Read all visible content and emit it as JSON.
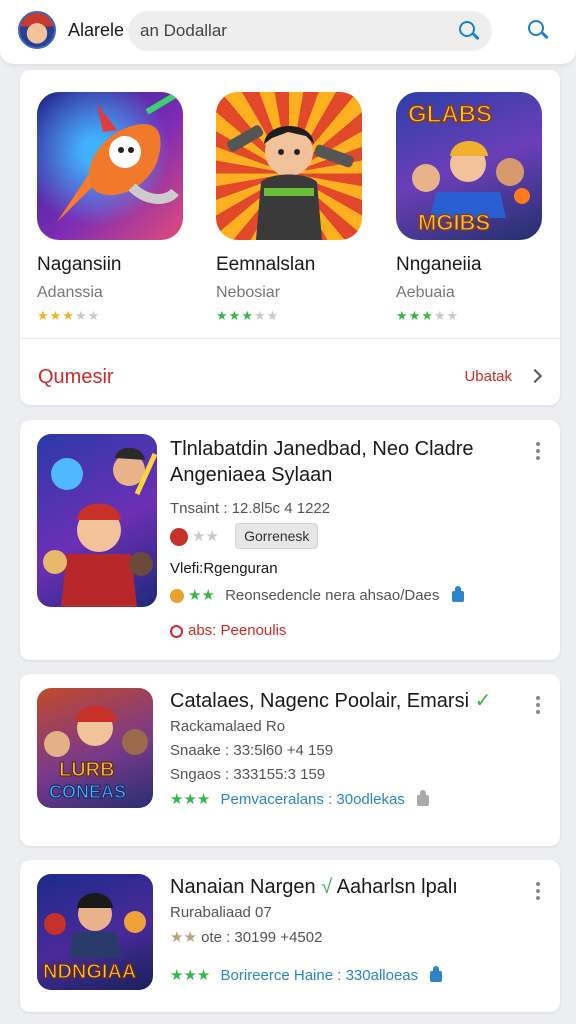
{
  "header": {
    "app_name": "Alarele",
    "search_placeholder": "an Dodallar"
  },
  "featured": {
    "items": [
      {
        "title": "Nagansiin",
        "subtitle": "Adanssia",
        "stars": [
          "on",
          "on",
          "on",
          "off",
          "off"
        ]
      },
      {
        "title": "Eemnalslan",
        "subtitle": "Nebosiar",
        "stars": [
          "green",
          "green",
          "green",
          "off",
          "off"
        ]
      },
      {
        "title": "Nnganeiia",
        "subtitle": "Aebuaia",
        "stars": [
          "green",
          "green",
          "green",
          "off",
          "off"
        ]
      }
    ],
    "section_label": "Qumesir",
    "see_all_label": "Ubatak"
  },
  "list": [
    {
      "title": "Tlnlabatdin Janedbad, Neo Cladre Angeniaea Sylaan",
      "line1": "Tnsaint : 12.8l5c 4 1222",
      "tag": "Gorrenesk",
      "line2": "Vlefi:Rgenguran",
      "line3": "Reonsedencle nera  ahsao/Daes",
      "line4": "abs: Peenoulis"
    },
    {
      "title": "Catalaes, Nagenc Poolair, Emarsi",
      "line1": "Rackamalaed Ro",
      "line2": "Snaake : 33:5l60 +4 159",
      "line3": "Sngaos : 333155:3 159",
      "line4": "Pemvaceralans : 30odlekas"
    },
    {
      "title": "Nanaian Nargen",
      "title_suffix": "Aaharlsn lpalı",
      "line1": "Rurabaliaad 07",
      "line2": "ote : 30199 +4502",
      "line3": "Borireerce Haine : 330alloeas"
    }
  ],
  "colors": {
    "accent_blue": "#1a7fd6",
    "accent_red": "#cf2a2a",
    "star_gold": "#f0b323",
    "star_green": "#3ab54a"
  }
}
